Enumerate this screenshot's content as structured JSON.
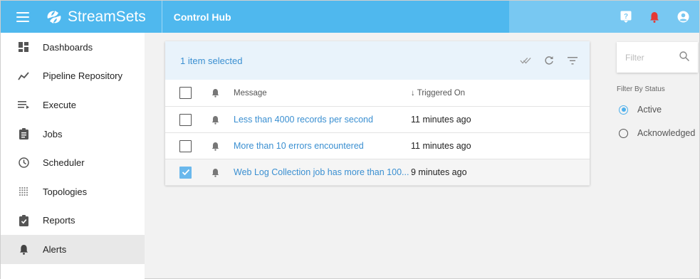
{
  "topbar": {
    "brand": "StreamSets",
    "app_title": "Control Hub",
    "icons": [
      "menu-icon",
      "help-icon",
      "notification-bell-icon",
      "user-account-icon"
    ],
    "notification_color": "#e53935"
  },
  "sidebar": {
    "items": [
      {
        "label": "Dashboards",
        "icon": "dashboard-icon"
      },
      {
        "label": "Pipeline Repository",
        "icon": "pipeline-icon"
      },
      {
        "label": "Execute",
        "icon": "execute-icon"
      },
      {
        "label": "Jobs",
        "icon": "jobs-icon"
      },
      {
        "label": "Scheduler",
        "icon": "clock-icon"
      },
      {
        "label": "Topologies",
        "icon": "topology-icon"
      },
      {
        "label": "Reports",
        "icon": "reports-icon"
      },
      {
        "label": "Alerts",
        "icon": "bell-icon"
      }
    ],
    "active_item": "Alerts"
  },
  "alerts": {
    "selection_text": "1 item selected",
    "columns": {
      "message": "Message",
      "triggered_on": "↓ Triggered On"
    },
    "rows": [
      {
        "message": "Less than 4000 records per second",
        "triggered_on": "11 minutes ago",
        "checked": false
      },
      {
        "message": "More than 10 errors encountered",
        "triggered_on": "11 minutes ago",
        "checked": false
      },
      {
        "message": "Web Log Collection job has more than 100...",
        "triggered_on": "9 minutes ago",
        "checked": true
      }
    ]
  },
  "filter": {
    "placeholder": "Filter",
    "status_label": "Filter By Status",
    "options": [
      {
        "label": "Active",
        "selected": true
      },
      {
        "label": "Acknowledged",
        "selected": false
      }
    ]
  },
  "colors": {
    "accent": "#4fb8ee",
    "link": "#3a8fd1"
  }
}
